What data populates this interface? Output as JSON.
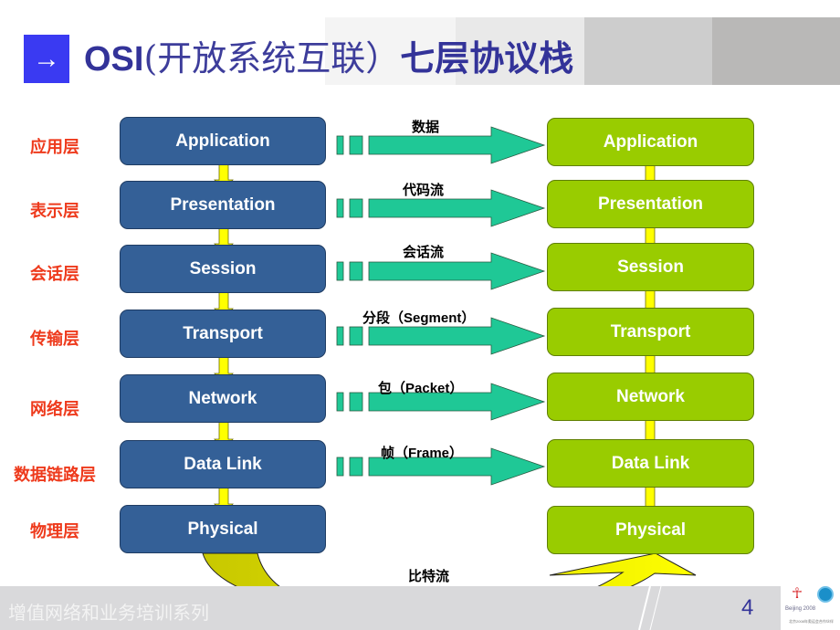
{
  "slide": {
    "title": {
      "marker": "→",
      "prefix": "OSI",
      "paren_text": "(开放系统互联）",
      "suffix": "七层协议栈"
    },
    "layers": [
      {
        "zh": "应用层",
        "en": "Application",
        "flow": "数据"
      },
      {
        "zh": "表示层",
        "en": "Presentation",
        "flow": "代码流"
      },
      {
        "zh": "会话层",
        "en": "Session",
        "flow": "会话流"
      },
      {
        "zh": "传输层",
        "en": "Transport",
        "flow": "分段（Segment）"
      },
      {
        "zh": "网络层",
        "en": "Network",
        "flow": "包（Packet）"
      },
      {
        "zh": "数据链路层",
        "en": "Data Link",
        "flow": "帧（Frame）"
      },
      {
        "zh": "物理层",
        "en": "Physical",
        "flow": "比特流"
      }
    ],
    "footer": {
      "series": "增值网络和业务培训系列",
      "page_number": "4",
      "logo_left": "Beijing 2008",
      "logo_right": "中国移动通信 CHINA MOBILE",
      "logo_caption": "北京2008年奥运会合作伙伴"
    },
    "colors": {
      "sender_box": "#346097",
      "receiver_box": "#99cc00",
      "flow_arrow": "#1fc896",
      "layer_arrow": "#ffff00",
      "layer_label": "#ee3a1c",
      "title": "#333399"
    }
  }
}
